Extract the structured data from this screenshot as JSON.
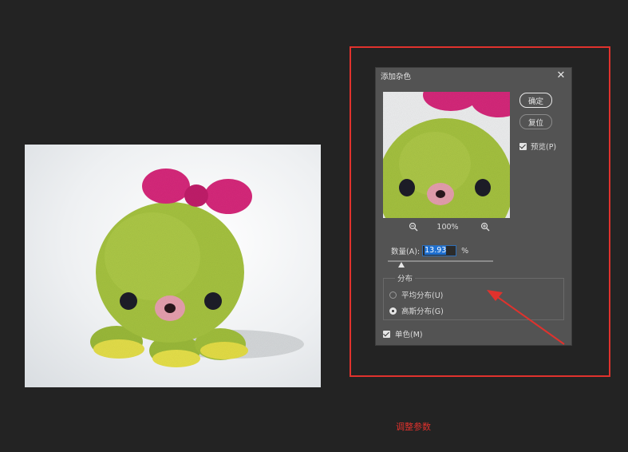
{
  "dialog": {
    "title": "添加杂色",
    "ok_label": "确定",
    "reset_label": "复位",
    "preview_label": "预览(P)",
    "zoom_level": "100%",
    "amount_label": "数量(A):",
    "amount_value": "13.93",
    "amount_unit": "%",
    "amount_slider_fraction": 0.13,
    "distribution_label": "分布",
    "uniform_label": "平均分布(U)",
    "gaussian_label": "高斯分布(G)",
    "monochrome_label": "单色(M)",
    "preview_checked": true,
    "monochrome_checked": true,
    "selected_distribution": "gaussian"
  },
  "annotation": {
    "caption": "调整参数",
    "color": "#e0322d"
  },
  "icons": {
    "zoom_out": "zoom-out-icon",
    "zoom_in": "zoom-in-icon",
    "close": "close-icon"
  }
}
